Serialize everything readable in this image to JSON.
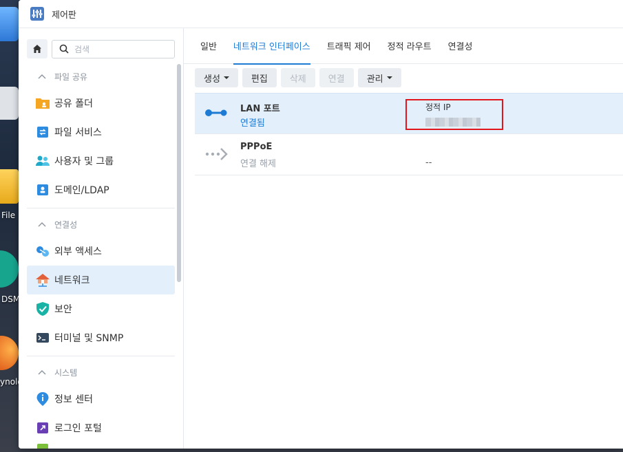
{
  "desktop": {
    "labels": [
      "File",
      "DSM",
      "ynolo"
    ]
  },
  "window": {
    "title": "제어판"
  },
  "sidebar": {
    "search_placeholder": "검색",
    "sections": [
      {
        "header": "파일 공유",
        "items": [
          {
            "label": "공유 폴더",
            "icon": "shared-folder-icon"
          },
          {
            "label": "파일 서비스",
            "icon": "file-services-icon"
          },
          {
            "label": "사용자 및 그룹",
            "icon": "users-group-icon"
          },
          {
            "label": "도메인/LDAP",
            "icon": "domain-ldap-icon"
          }
        ]
      },
      {
        "header": "연결성",
        "items": [
          {
            "label": "외부 액세스",
            "icon": "external-access-icon"
          },
          {
            "label": "네트워크",
            "icon": "network-icon",
            "active": true
          },
          {
            "label": "보안",
            "icon": "security-shield-icon"
          },
          {
            "label": "터미널 및 SNMP",
            "icon": "terminal-icon"
          }
        ]
      },
      {
        "header": "시스템",
        "items": [
          {
            "label": "정보 센터",
            "icon": "info-center-icon"
          },
          {
            "label": "로그인 포털",
            "icon": "login-portal-icon"
          }
        ]
      }
    ]
  },
  "tabs": [
    {
      "label": "일반"
    },
    {
      "label": "네트워크 인터페이스",
      "active": true
    },
    {
      "label": "트래픽 제어"
    },
    {
      "label": "정적 라우트"
    },
    {
      "label": "연결성"
    }
  ],
  "toolbar": {
    "create": "생성",
    "edit": "편집",
    "delete": "삭제",
    "connect": "연결",
    "manage": "관리"
  },
  "interfaces": [
    {
      "name": "LAN 포트",
      "status": "연결됨",
      "ip_mode": "정적 IP",
      "ip": "",
      "selected": true
    },
    {
      "name": "PPPoE",
      "status": "연결 해제",
      "ip_mode": "",
      "ip": "--",
      "selected": false
    }
  ],
  "colors": {
    "accent": "#1d7bd4",
    "highlight_box": "#e3151c",
    "selected_row": "#e3effb"
  }
}
